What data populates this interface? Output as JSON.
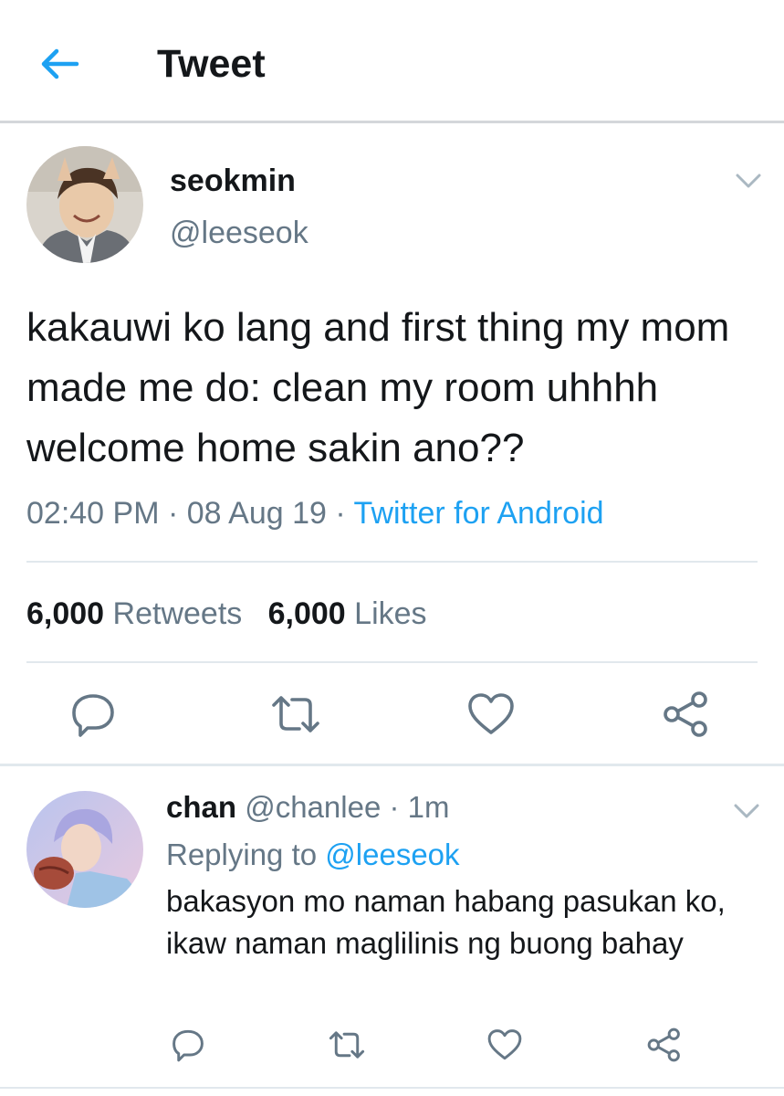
{
  "header": {
    "title": "Tweet"
  },
  "tweet": {
    "display_name": "seokmin",
    "handle": "@leeseok",
    "text": "kakauwi ko lang and first thing my mom made me do: clean my room uhhhh welcome home sakin ano??",
    "time": "02:40 PM",
    "date": "08 Aug 19",
    "source": "Twitter for Android",
    "retweets_count": "6,000",
    "retweets_label": "Retweets",
    "likes_count": "6,000",
    "likes_label": "Likes",
    "dot": "·"
  },
  "reply": {
    "display_name": "chan",
    "handle": "@chanlee",
    "age": "1m",
    "dot": "·",
    "replying_label": "Replying to",
    "replying_handle": "@leeseok",
    "text": "bakasyon mo naman habang pasukan ko, ikaw naman maglilinis ng buong bahay"
  },
  "icons": [
    "back-arrow-icon",
    "chevron-down-icon",
    "reply-icon",
    "retweet-icon",
    "like-icon",
    "share-icon"
  ],
  "colors": {
    "accent": "#1da1f2",
    "text": "#14171a",
    "secondary": "#657786",
    "divider": "#e1e8ed"
  }
}
